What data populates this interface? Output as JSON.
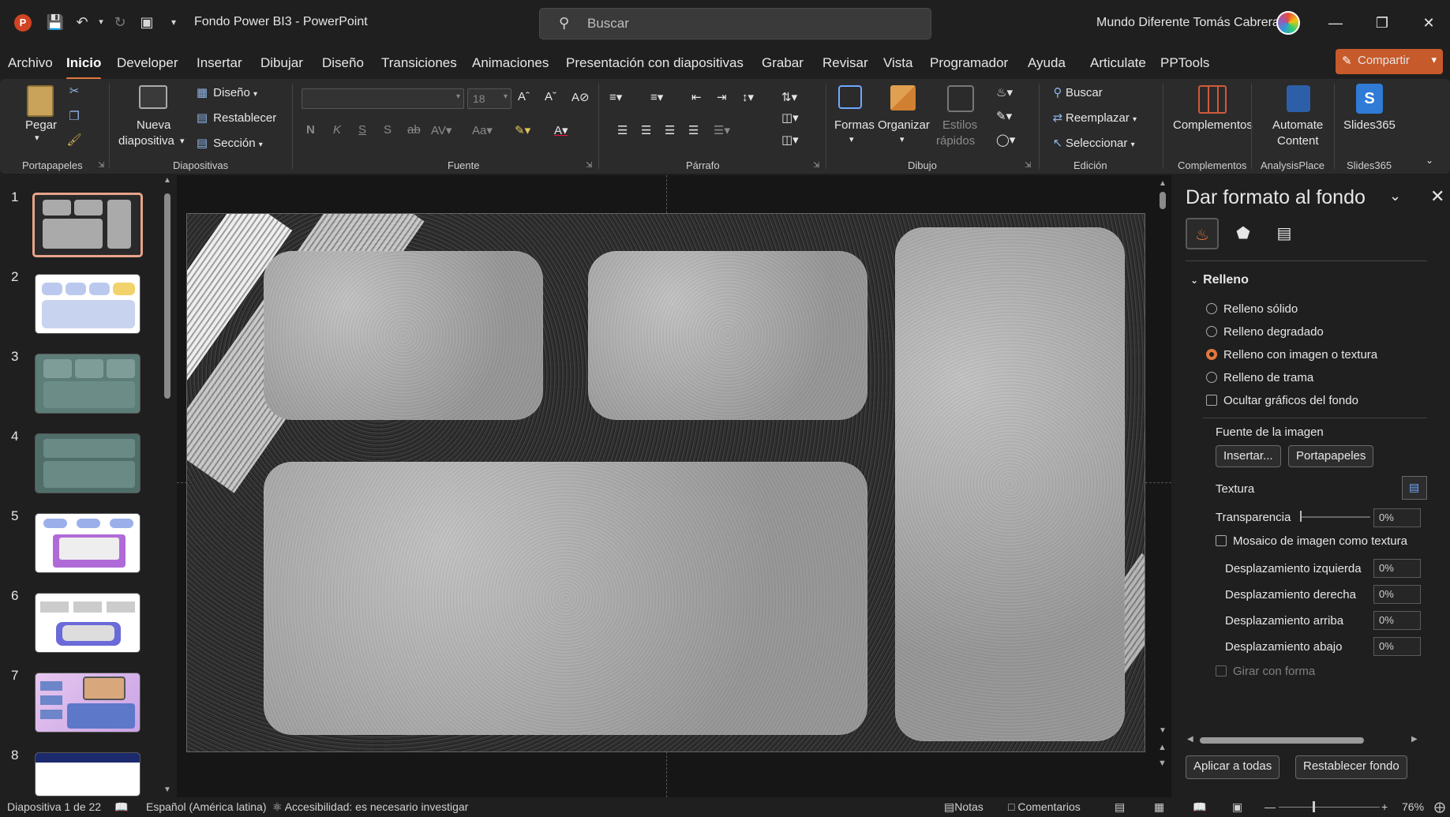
{
  "titlebar": {
    "doc_title": "Fondo Power BI3  -  PowerPoint",
    "search_placeholder": "Buscar",
    "user_name": "Mundo Diferente Tomás Cabrera"
  },
  "menu": {
    "tabs": [
      "Archivo",
      "Inicio",
      "Developer",
      "Insertar",
      "Dibujar",
      "Diseño",
      "Transiciones",
      "Animaciones",
      "Presentación con diapositivas",
      "Grabar",
      "Revisar",
      "Vista",
      "Programador",
      "Ayuda",
      "Articulate",
      "PPTools"
    ],
    "active": "Inicio",
    "share_label": "Compartir"
  },
  "ribbon": {
    "groups": {
      "portapapeles": "Portapapeles",
      "diapositivas": "Diapositivas",
      "fuente": "Fuente",
      "parrafo": "Párrafo",
      "dibujo": "Dibujo",
      "edicion": "Edición",
      "complementos": "Complementos",
      "analysisplace": "AnalysisPlace",
      "slides365": "Slides365"
    },
    "paste": "Pegar",
    "new_slide_1": "Nueva",
    "new_slide_2": "diapositiva",
    "layout": "Diseño",
    "reset": "Restablecer",
    "section": "Sección",
    "font_size": "18",
    "bold": "N",
    "italic": "K",
    "underline": "S",
    "strike": "S",
    "shapes": "Formas",
    "arrange": "Organizar",
    "quick_styles_1": "Estilos",
    "quick_styles_2": "rápidos",
    "find": "Buscar",
    "replace": "Reemplazar",
    "select": "Seleccionar",
    "addins": "Complementos",
    "automate_1": "Automate",
    "automate_2": "Content",
    "slides365": "Slides365"
  },
  "slides": {
    "numbers": [
      "1",
      "2",
      "3",
      "4",
      "5",
      "6",
      "7",
      "8"
    ],
    "selected": "1"
  },
  "pane": {
    "title": "Dar formato al fondo",
    "section": "Relleno",
    "options": [
      "Relleno sólido",
      "Relleno degradado",
      "Relleno con imagen o textura",
      "Relleno de trama"
    ],
    "selected_option": "Relleno con imagen o textura",
    "hide_graphics": "Ocultar gráficos del fondo",
    "image_source": "Fuente de la imagen",
    "insert_btn": "Insertar...",
    "clipboard_btn": "Portapapeles",
    "texture": "Textura",
    "transparency": "Transparencia",
    "transparency_value": "0%",
    "tile": "Mosaico de imagen como textura",
    "offset_left": "Desplazamiento izquierda",
    "offset_right": "Desplazamiento derecha",
    "offset_top": "Desplazamiento arriba",
    "offset_bottom": "Desplazamiento abajo",
    "offset_value": "0%",
    "rotate": "Girar con forma",
    "apply_all": "Aplicar a todas",
    "reset_bg": "Restablecer fondo"
  },
  "status": {
    "slide_info": "Diapositiva 1 de 22",
    "language": "Español (América latina)",
    "accessibility": "Accesibilidad: es necesario investigar",
    "notes": "Notas",
    "comments": "Comentarios",
    "zoom": "76%"
  },
  "colors": {
    "accent": "#e2783e",
    "share": "#c75a2a",
    "background": "#1f1f1f"
  }
}
